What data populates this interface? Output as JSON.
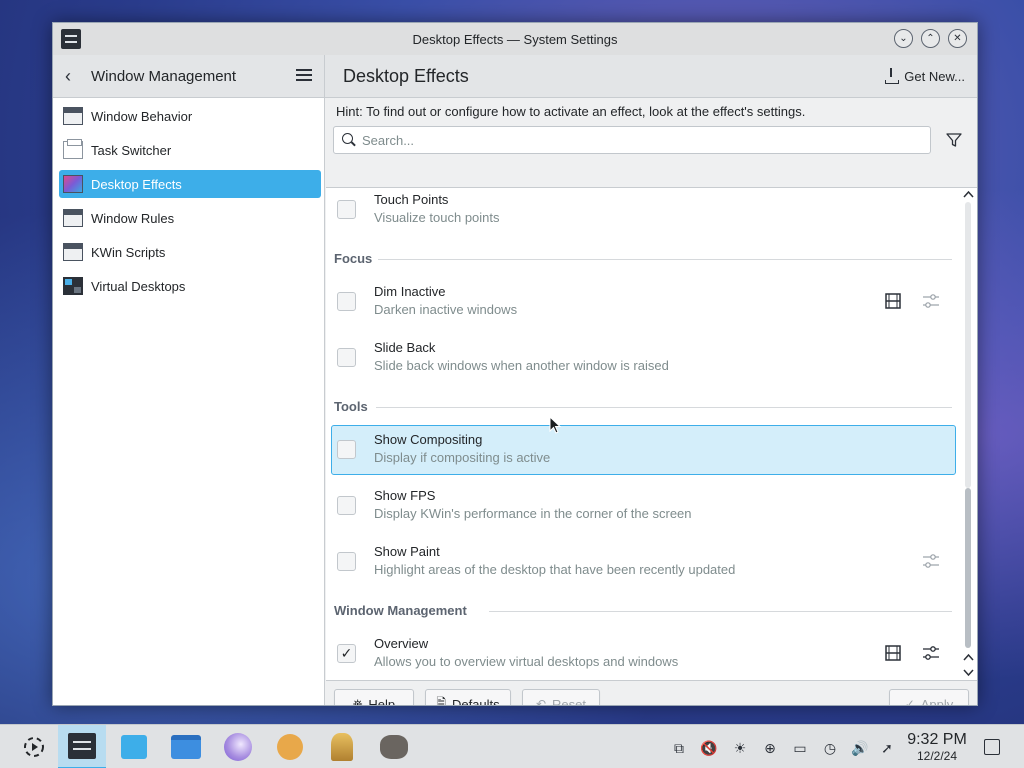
{
  "window": {
    "title": "Desktop Effects — System Settings",
    "controls": {
      "minimize": "⌄",
      "maximize": "⌃",
      "close": "✕"
    }
  },
  "header": {
    "back_title": "Window Management",
    "page_title": "Desktop Effects",
    "get_new_label": "Get New..."
  },
  "sidebar": {
    "items": [
      {
        "label": "Window Behavior",
        "icon": "window-behavior-icon"
      },
      {
        "label": "Task Switcher",
        "icon": "task-switcher-icon"
      },
      {
        "label": "Desktop Effects",
        "icon": "desktop-effects-icon",
        "active": true
      },
      {
        "label": "Window Rules",
        "icon": "window-rules-icon"
      },
      {
        "label": "KWin Scripts",
        "icon": "kwin-scripts-icon"
      },
      {
        "label": "Virtual Desktops",
        "icon": "virtual-desktops-icon"
      }
    ]
  },
  "main": {
    "hint": "Hint: To find out or configure how to activate an effect, look at the effect's settings.",
    "search": {
      "placeholder": "Search...",
      "value": ""
    }
  },
  "effects": {
    "touch_points": {
      "name": "Touch Points",
      "desc": "Visualize touch points",
      "checked": false
    },
    "focus_header": "Focus",
    "dim_inactive": {
      "name": "Dim Inactive",
      "desc": "Darken inactive windows",
      "checked": false
    },
    "slide_back": {
      "name": "Slide Back",
      "desc": "Slide back windows when another window is raised",
      "checked": false
    },
    "tools_header": "Tools",
    "show_compositing": {
      "name": "Show Compositing",
      "desc": "Display if compositing is active",
      "checked": false
    },
    "show_fps": {
      "name": "Show FPS",
      "desc": "Display KWin's performance in the corner of the screen",
      "checked": false
    },
    "show_paint": {
      "name": "Show Paint",
      "desc": "Highlight areas of the desktop that have been recently updated",
      "checked": false
    },
    "wm_header": "Window Management",
    "overview": {
      "name": "Overview",
      "desc": "Allows you to overview virtual desktops and windows",
      "checked": true,
      "check_glyph": "✓"
    }
  },
  "footer": {
    "help_label": "Help",
    "defaults_label": "Defaults",
    "reset_label": "Reset",
    "apply_label": "Apply"
  },
  "taskbar": {
    "time": "9:32 PM",
    "date": "12/2/24"
  },
  "colors": {
    "accent": "#3daee9",
    "hover_bg": "#d4eefa",
    "window_bg": "#eff0f1",
    "sidebar_active": "#3daee9"
  }
}
